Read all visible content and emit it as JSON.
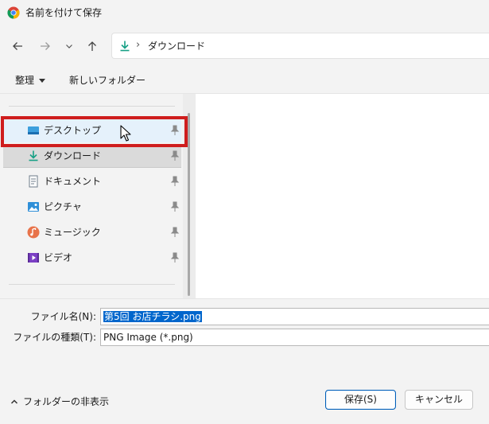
{
  "window": {
    "title": "名前を付けて保存",
    "app_icon": "chrome-icon"
  },
  "navigation": {
    "back_icon": "arrow-left-icon",
    "forward_icon": "arrow-right-icon",
    "history_icon": "chevron-down-icon",
    "up_icon": "arrow-up-icon",
    "address": {
      "icon": "download-icon",
      "separator": "›",
      "path": "ダウンロード"
    }
  },
  "commands": {
    "organize": "整理",
    "new_folder": "新しいフォルダー"
  },
  "sidebar": {
    "items": [
      {
        "label": "デスクトップ",
        "icon": "desktop-icon",
        "pinned": true
      },
      {
        "label": "ダウンロード",
        "icon": "download-icon",
        "pinned": true
      },
      {
        "label": "ドキュメント",
        "icon": "document-icon",
        "pinned": true
      },
      {
        "label": "ピクチャ",
        "icon": "pictures-icon",
        "pinned": true
      },
      {
        "label": "ミュージック",
        "icon": "music-icon",
        "pinned": true
      },
      {
        "label": "ビデオ",
        "icon": "video-icon",
        "pinned": true
      }
    ]
  },
  "form": {
    "filename_label": "ファイル名(N):",
    "filename_value": "第5回 お店チラシ.png",
    "filetype_label": "ファイルの種類(T):",
    "filetype_value": "PNG Image (*.png)"
  },
  "footer": {
    "hide_folders": "フォルダーの非表示",
    "save_button": "保存(S)",
    "cancel_button": "キャンセル"
  },
  "colors": {
    "highlight_border": "#cf1d1d",
    "accent": "#005fb8",
    "selection": "#0066cc"
  }
}
